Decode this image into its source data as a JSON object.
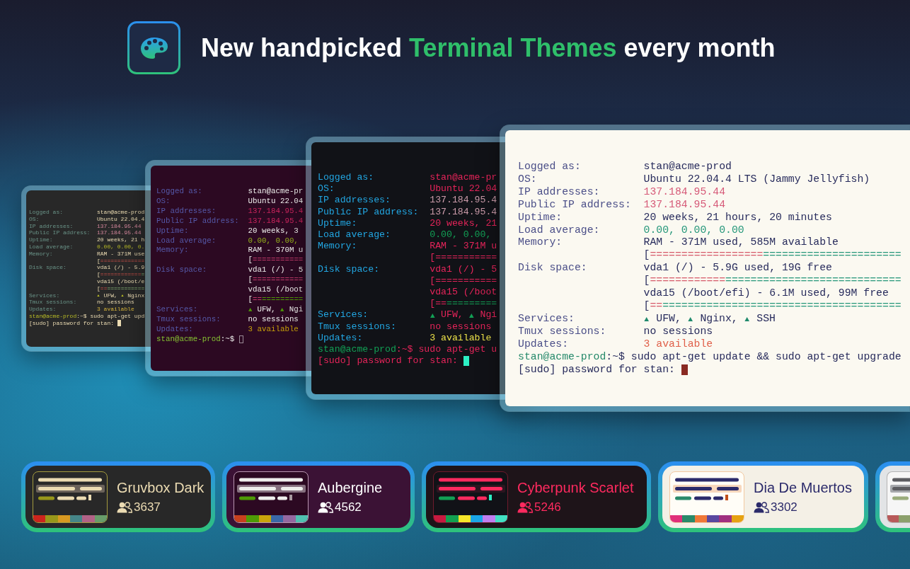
{
  "header": {
    "title": "New handpicked **Terminal Themes** every month"
  },
  "terminals": [
    {
      "kind": "gruvbox",
      "lines": [
        {
          "kind": "plain",
          "label": "Logged as:",
          "value": "stan@acme-prod"
        },
        {
          "kind": "plain",
          "label": "OS:",
          "value": "Ubuntu 22.04.4"
        },
        {
          "kind": "ip",
          "label": "IP addresses:",
          "value": "137.184.95.44"
        },
        {
          "kind": "ip",
          "label": "Public IP address:",
          "value": "137.184.95.44"
        },
        {
          "kind": "plain",
          "label": "Uptime:",
          "value": "20 weeks, 21 h"
        },
        {
          "kind": "load",
          "label": "Load average:",
          "value": "0.00, 0.00, 0."
        },
        {
          "kind": "plain",
          "label": "Memory:",
          "value": "RAM - 371M use"
        },
        {
          "kind": "bar",
          "open": "[",
          "used": "============="
        },
        {
          "kind": "plain",
          "label": "Disk space:",
          "value": "vda1 (/) - 5.9"
        },
        {
          "kind": "bar",
          "open": "[",
          "used": "============",
          "free": "="
        },
        {
          "kind": "plain",
          "value": "vda15 (/boot/e"
        },
        {
          "kind": "bar",
          "open": "[",
          "used": "==",
          "free": "==========="
        },
        {
          "kind": "services",
          "label": "Services:",
          "services": [
            {
              "name": "UFW,",
              "running": true
            },
            {
              "name": "Nginx",
              "running": true
            }
          ]
        },
        {
          "kind": "plain",
          "label": "Tmux sessions:",
          "value": "no sessions"
        },
        {
          "kind": "updates",
          "label": "Updates:",
          "value": "3 available"
        },
        {
          "kind": "prompt",
          "host": "stan@acme-prod",
          "path": ":~$",
          "command": "sudo apt-get upd"
        },
        {
          "kind": "sudo",
          "text": "[sudo] password for stan:",
          "cursor_solid": true
        }
      ]
    },
    {
      "kind": "aubergine",
      "lines": [
        {
          "kind": "plain",
          "label": "Logged as:",
          "value": "stan@acme-pr"
        },
        {
          "kind": "plain",
          "label": "OS:",
          "value": "Ubuntu 22.04"
        },
        {
          "kind": "ip",
          "label": "IP addresses:",
          "value": "137.184.95.4"
        },
        {
          "kind": "ip",
          "label": "Public IP address:",
          "value": "137.184.95.4"
        },
        {
          "kind": "plain",
          "label": "Uptime:",
          "value": "20 weeks, 3"
        },
        {
          "kind": "load",
          "label": "Load average:",
          "value": "0.00, 0.00,"
        },
        {
          "kind": "plain",
          "label": "Memory:",
          "value": "RAM - 370M u"
        },
        {
          "kind": "bar",
          "open": "[",
          "used": "==========="
        },
        {
          "kind": "plain",
          "label": "Disk space:",
          "value": "vda1 (/) - 5"
        },
        {
          "kind": "bar",
          "open": "[",
          "used": "==========="
        },
        {
          "kind": "plain",
          "value": "vda15 (/boot"
        },
        {
          "kind": "bar",
          "open": "[",
          "used": "==",
          "free": "========="
        },
        {
          "kind": "services",
          "label": "Services:",
          "services": [
            {
              "name": "UFW,",
              "running": true
            },
            {
              "name": "Ngi",
              "running": true
            }
          ]
        },
        {
          "kind": "plain",
          "label": "Tmux sessions:",
          "value": "no sessions"
        },
        {
          "kind": "updates",
          "label": "Updates:",
          "value": "3 available"
        },
        {
          "kind": "prompt",
          "host": "stan@acme-prod",
          "path": ":~$",
          "cursor_solid": false
        }
      ]
    },
    {
      "kind": "cyberpunk",
      "lines": [
        {
          "kind": "plain",
          "label": "Logged as:",
          "value": "stan@acme-pr"
        },
        {
          "kind": "plain",
          "label": "OS:",
          "value": "Ubuntu 22.04"
        },
        {
          "kind": "ip",
          "label": "IP addresses:",
          "value": "137.184.95.4"
        },
        {
          "kind": "ip",
          "label": "Public IP address:",
          "value": "137.184.95.4"
        },
        {
          "kind": "plain",
          "label": "Uptime:",
          "value": "20 weeks, 21"
        },
        {
          "kind": "load",
          "label": "Load average:",
          "value": "0.00, 0.00,"
        },
        {
          "kind": "plain",
          "label": "Memory:",
          "value": "RAM - 371M u"
        },
        {
          "kind": "bar",
          "open": "[",
          "used": "==========="
        },
        {
          "kind": "plain",
          "label": "Disk space:",
          "value": "vda1 (/) - 5"
        },
        {
          "kind": "bar",
          "open": "[",
          "used": "==========="
        },
        {
          "kind": "plain",
          "value": "vda15 (/boot"
        },
        {
          "kind": "bar",
          "open": "[",
          "used": "==",
          "free": "========="
        },
        {
          "kind": "services",
          "label": "Services:",
          "services": [
            {
              "name": "UFW,",
              "running": true
            },
            {
              "name": "Ngi",
              "running": true
            }
          ]
        },
        {
          "kind": "plain",
          "label": "Tmux sessions:",
          "value": "no sessions"
        },
        {
          "kind": "updates",
          "label": "Updates:",
          "value": "3 available"
        },
        {
          "kind": "prompt",
          "host": "stan@acme-prod",
          "path": ":~$",
          "command": "sudo apt-get u"
        },
        {
          "kind": "sudo",
          "text": "[sudo] password for stan:",
          "cursor_solid": true
        }
      ]
    },
    {
      "kind": "muertos",
      "lines": [
        {
          "kind": "plain",
          "label": "Logged as:",
          "value": "stan@acme-prod"
        },
        {
          "kind": "plain",
          "label": "OS:",
          "value": "Ubuntu 22.04.4 LTS (Jammy Jellyfish)"
        },
        {
          "kind": "ip",
          "label": "IP addresses:",
          "value": "137.184.95.44"
        },
        {
          "kind": "ip",
          "label": "Public IP address:",
          "value": "137.184.95.44"
        },
        {
          "kind": "plain",
          "label": "Uptime:",
          "value": "20 weeks, 21 hours, 20 minutes"
        },
        {
          "kind": "load",
          "label": "Load average:",
          "value": "0.00, 0.00, 0.00"
        },
        {
          "kind": "plain",
          "label": "Memory:",
          "value": "RAM - 371M used, 585M available"
        },
        {
          "kind": "bar",
          "open": "[",
          "used": "==================",
          "free": "======================"
        },
        {
          "kind": "plain",
          "label": "Disk space:",
          "value": "vda1 (/) - 5.9G used, 19G free"
        },
        {
          "kind": "bar",
          "open": "[",
          "used": "============",
          "free": "============================"
        },
        {
          "kind": "plain",
          "value": "vda15 (/boot/efi) - 6.1M used, 99M free"
        },
        {
          "kind": "bar",
          "open": "[",
          "used": "==",
          "free": "======================================"
        },
        {
          "kind": "services",
          "label": "Services:",
          "services": [
            {
              "name": "UFW,",
              "running": true
            },
            {
              "name": "Nginx,",
              "running": true
            },
            {
              "name": "SSH",
              "running": true
            }
          ]
        },
        {
          "kind": "plain",
          "label": "Tmux sessions:",
          "value": "no sessions"
        },
        {
          "kind": "updates",
          "label": "Updates:",
          "value": "3 available"
        },
        {
          "kind": "prompt",
          "host": "stan@acme-prod",
          "path": ":~$",
          "command": "sudo apt-get update && sudo apt-get upgrade"
        },
        {
          "kind": "sudo",
          "text": "[sudo] password for stan:",
          "cursor_solid": true
        }
      ]
    }
  ],
  "theme_cards": [
    {
      "kind": "gruvbox",
      "name": "Gruvbox Dark",
      "users": "3637",
      "swatches": [
        {
          "color": "#cc241d"
        },
        {
          "color": "#98971a"
        },
        {
          "color": "#d79921"
        },
        {
          "color": "#458588"
        },
        {
          "color": "#b16286"
        },
        {
          "color": "#689d6a"
        }
      ]
    },
    {
      "kind": "aubergine",
      "name": "Aubergine",
      "users": "4562",
      "swatches": [
        {
          "color": "#c8401e"
        },
        {
          "color": "#4e9a06"
        },
        {
          "color": "#c9a40c"
        },
        {
          "color": "#3a68a8"
        },
        {
          "color": "#9468a0"
        },
        {
          "color": "#50c0b0"
        }
      ]
    },
    {
      "kind": "cyberpunk",
      "name": "Cyberpunk Scarlet",
      "users": "5246",
      "swatches": [
        {
          "color": "#c81a40"
        },
        {
          "color": "#12a050"
        },
        {
          "color": "#f5e62a"
        },
        {
          "color": "#1aa6e6"
        },
        {
          "color": "#c07ef0"
        },
        {
          "color": "#42e0c2"
        }
      ]
    },
    {
      "kind": "muertos",
      "name": "Dia De Muertos",
      "users": "3302",
      "swatches": [
        {
          "color": "#e0307a"
        },
        {
          "color": "#2a8a6a"
        },
        {
          "color": "#f07838"
        },
        {
          "color": "#5a48a0"
        },
        {
          "color": "#a03080"
        },
        {
          "color": "#e6a212"
        }
      ]
    },
    {
      "kind": "gray",
      "swatches": [
        {
          "color": "#b85a5a"
        },
        {
          "color": "#8ca06c"
        }
      ]
    }
  ]
}
